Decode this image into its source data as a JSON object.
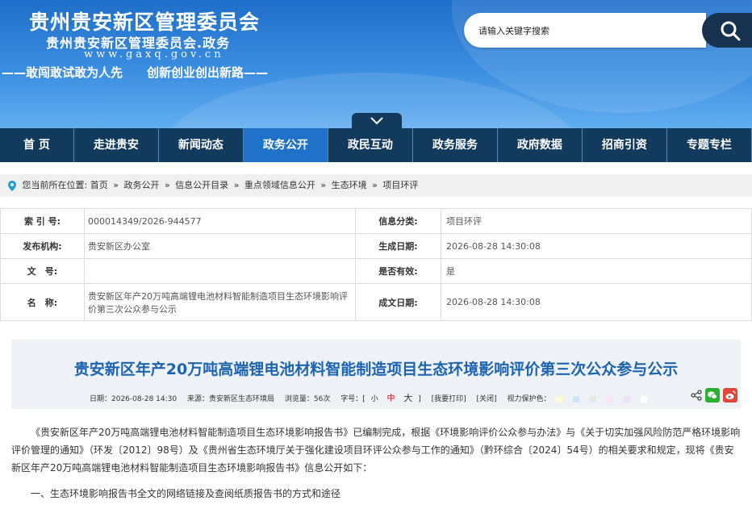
{
  "header": {
    "title": "贵州贵安新区管理委员会",
    "subtitle": "贵州贵安新区管理委员会.政务",
    "url": "www.gaxq.gov.cn",
    "slogan": "——敢闯敢试敢为人先　　创新创业创出新路——"
  },
  "search": {
    "placeholder": "请输入关键字搜索"
  },
  "nav": {
    "items": [
      {
        "label": "首  页"
      },
      {
        "label": "走进贵安"
      },
      {
        "label": "新闻动态"
      },
      {
        "label": "政务公开",
        "active": true
      },
      {
        "label": "政民互动"
      },
      {
        "label": "政务服务"
      },
      {
        "label": "政府数据"
      },
      {
        "label": "招商引资"
      },
      {
        "label": "专题专栏"
      }
    ]
  },
  "breadcrumb": {
    "prefix": "您当前所在位置:",
    "items": [
      "首页",
      "政务公开",
      "信息公开目录",
      "重点领域信息公开",
      "生态环境",
      "项目环评"
    ],
    "separator": "»"
  },
  "meta": {
    "index_label": "索 引 号:",
    "index_value": "000014349/2026-944577",
    "category_label": "信息分类:",
    "category_value": "项目环评",
    "publisher_label": "发布机构:",
    "publisher_value": "贵安新区办公室",
    "gen_date_label": "生成日期:",
    "gen_date_value": "2026-08-28 14:30:08",
    "docno_label": "文　号:",
    "docno_value": "",
    "valid_label": "是否有效:",
    "valid_value": "是",
    "name_label": "名　称:",
    "name_value": "贵安新区年产20万吨高端锂电池材料智能制造项目生态环境影响评价第三次公众参与公示",
    "written_label": "成文日期:",
    "written_value": "2026-08-28 14:30:08"
  },
  "article": {
    "title": "贵安新区年产20万吨高端锂电池材料智能制造项目生态环境影响评价第三次公众参与公示",
    "date": "日期：2026-08-28 14:30",
    "source": "来源：贵安新区生态环境局",
    "views": "浏览量：56次",
    "font_label": "字号：[",
    "font_small": "小",
    "font_medium": "中",
    "font_large": "大",
    "font_close": "]",
    "print": "[我要打印]",
    "close": "[关闭]",
    "eye_label": "视力保护色：",
    "eye_colors": [
      "#fdfbd0",
      "#cde6f7",
      "#e7e7e7",
      "#fbe3ef",
      "#e9e0f3",
      "#ffffff"
    ],
    "paragraph_1": "《贵安新区年产20万吨高端锂电池材料智能制造项目生态环境影响报告书》已编制完成，根据《环境影响评价公众参与办法》与《关于切实加强风险防范严格环境影响评价管理的通知》（环发〔2012〕98号）及《贵州省生态环境厅关于强化建设项目环评公众参与工作的通知》（黔环综合〔2024〕54号）的相关要求和规定，现将《贵安新区年产20万吨高端锂电池材料智能制造项目生态环境影响报告书》信息公开如下：",
    "heading_1": "一、生态环境影响报告书全文的网络链接及查阅纸质报告书的方式和途径"
  }
}
